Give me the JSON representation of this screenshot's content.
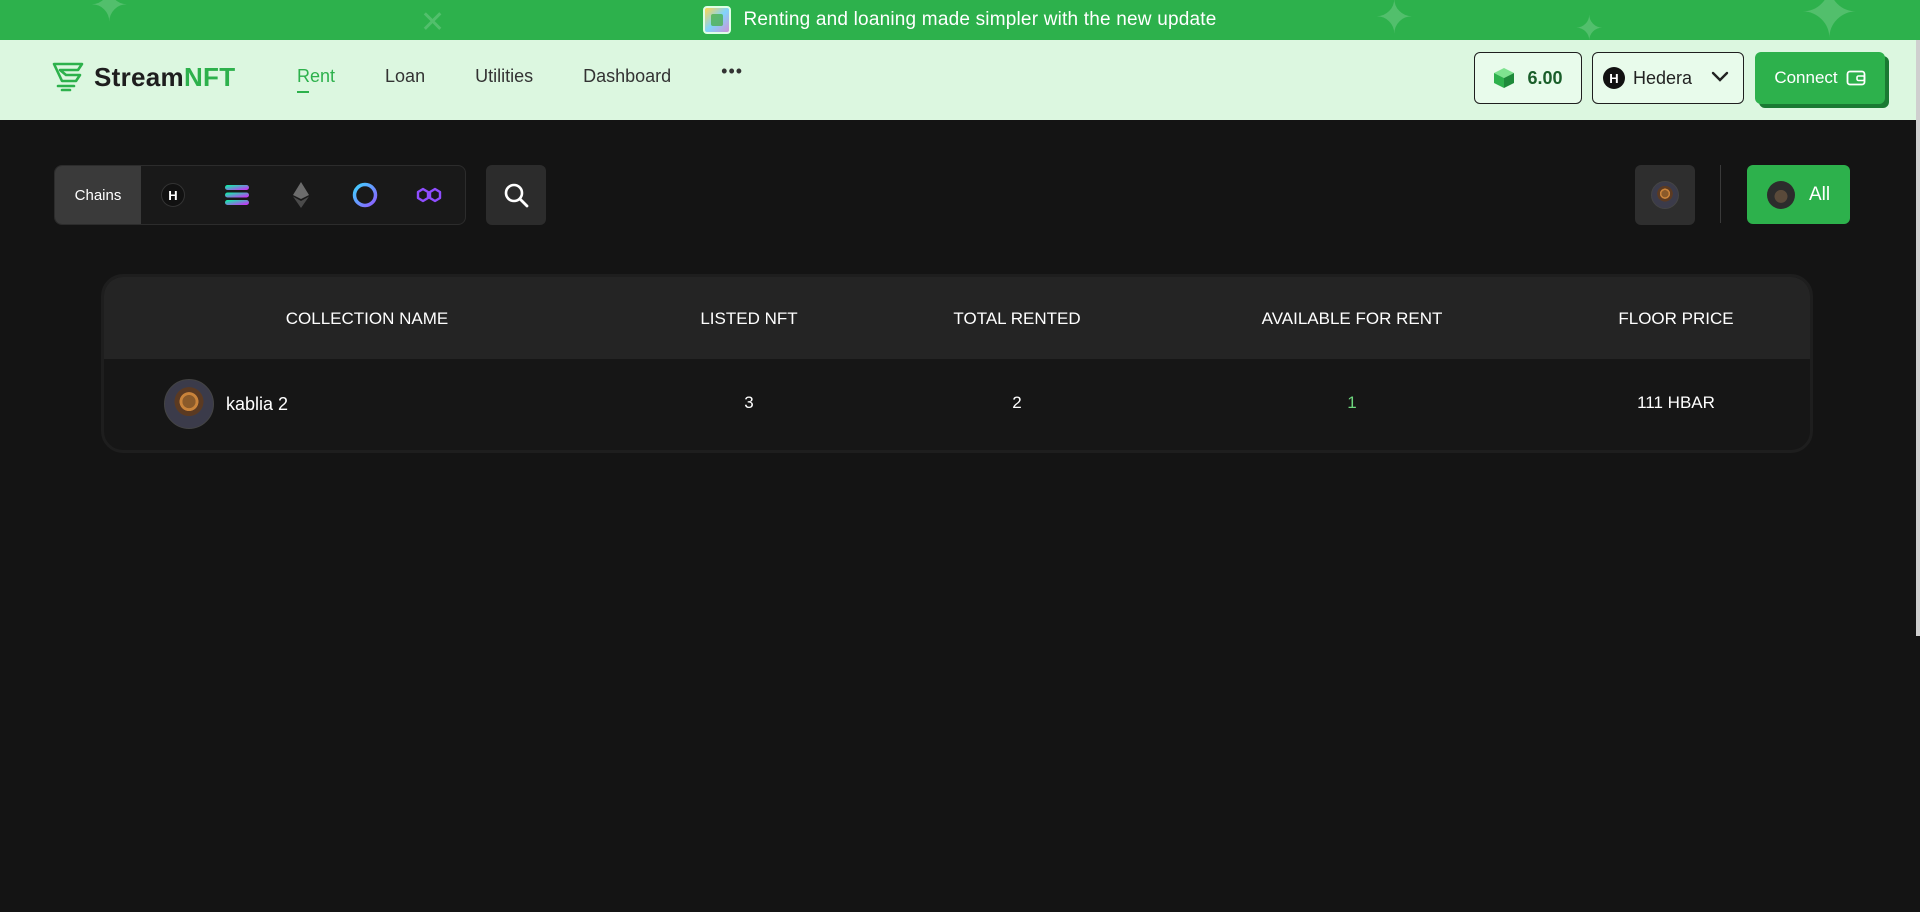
{
  "banner": {
    "text": "Renting and loaning made simpler with the new update"
  },
  "header": {
    "brand_prefix": "Stream",
    "brand_suffix": "NFT",
    "nav": [
      {
        "label": "Rent",
        "active": true
      },
      {
        "label": "Loan",
        "active": false
      },
      {
        "label": "Utilities",
        "active": false
      },
      {
        "label": "Dashboard",
        "active": false
      }
    ],
    "more_label": "•••",
    "balance": "6.00",
    "network": {
      "badge": "H",
      "label": "Hedera"
    },
    "connect_label": "Connect"
  },
  "filters": {
    "chains_label": "Chains",
    "chains": [
      {
        "name": "hedera",
        "badge": "H"
      },
      {
        "name": "solana"
      },
      {
        "name": "ethereum"
      },
      {
        "name": "circle-chain"
      },
      {
        "name": "polygon"
      }
    ],
    "all_label": "All"
  },
  "table": {
    "columns": [
      "COLLECTION NAME",
      "LISTED NFT",
      "TOTAL RENTED",
      "AVAILABLE FOR RENT",
      "FLOOR PRICE"
    ],
    "rows": [
      {
        "name": "kablia 2",
        "listed": "3",
        "rented": "2",
        "available": "1",
        "floor": "111 HBAR"
      }
    ]
  },
  "colors": {
    "accent": "#2db14c",
    "header_bg": "#dcf7e0",
    "page_bg": "#141414",
    "available_text": "#6ed67e"
  }
}
